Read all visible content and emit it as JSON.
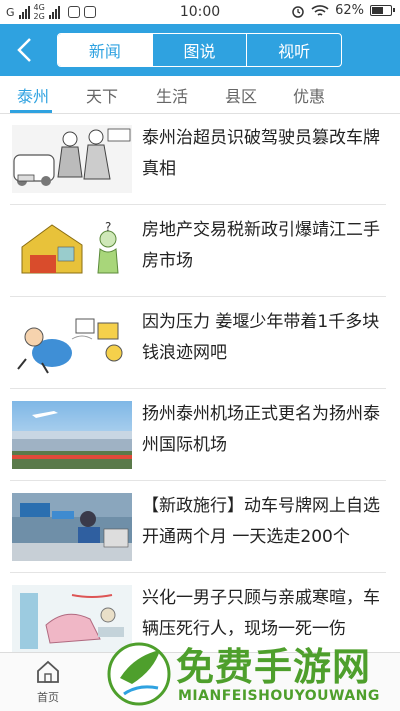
{
  "status_bar": {
    "sim_label": "G",
    "net_label_top": "4G",
    "net_label_bottom": "2G",
    "time": "10:00",
    "battery": "62%",
    "battery_level": 0.62
  },
  "nav": {
    "segments": [
      "新闻",
      "图说",
      "视听"
    ],
    "active_segment": 0
  },
  "categories": {
    "items": [
      "泰州",
      "天下",
      "生活",
      "县区",
      "优惠"
    ],
    "active": 0
  },
  "news": [
    {
      "title": "泰州治超员识破驾驶员篡改车牌真相",
      "thumb": "cartoon-traffic-police-thumbnail"
    },
    {
      "title": "房地产交易税新政引爆靖江二手房市场",
      "thumb": "cartoon-house-tax-thumbnail"
    },
    {
      "title": "因为压力 姜堰少年带着1千多块钱浪迹网吧",
      "thumb": "cartoon-boy-pressure-thumbnail"
    },
    {
      "title": "扬州泰州机场正式更名为扬州泰州国际机场",
      "thumb": "airport-photo-thumbnail"
    },
    {
      "title": "【新政施行】动车号牌网上自选开通两个月 一天选走200个",
      "thumb": "dmv-office-photo-thumbnail"
    },
    {
      "title": "兴化一男子只顾与亲戚寒暄，车辆压死行人，现场一死一伤",
      "thumb": "accident-illustration-thumbnail"
    }
  ],
  "bottom_bar": {
    "home_label": "首页"
  },
  "watermark": {
    "text": "免费手游网",
    "subtext": "MIANFEISHOUYOUWANG"
  },
  "colors": {
    "accent": "#2fa2e0",
    "watermark": "#4e9f2c"
  }
}
